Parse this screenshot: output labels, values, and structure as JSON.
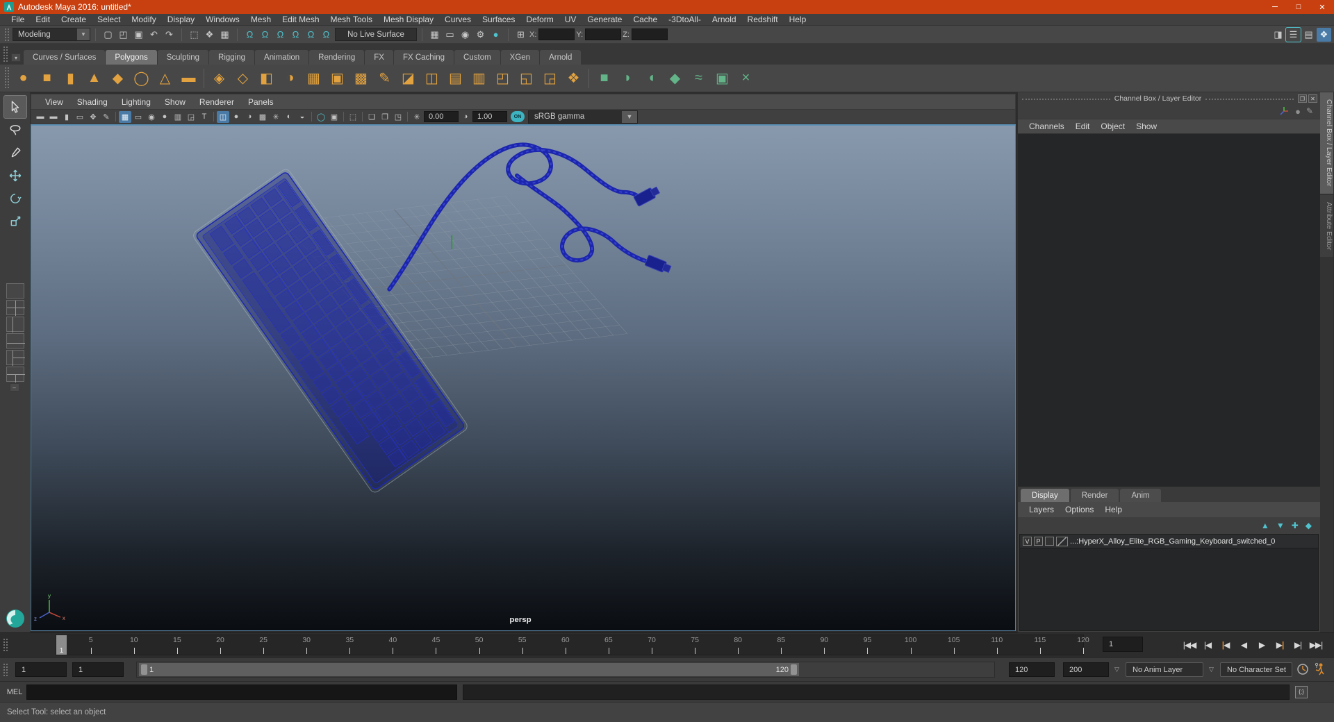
{
  "title_bar": {
    "title": "Autodesk Maya 2016: untitled*",
    "window_controls": [
      {
        "name": "minimize-button",
        "glyph": "─"
      },
      {
        "name": "maximize-button",
        "glyph": "□"
      },
      {
        "name": "close-button",
        "glyph": "✕"
      }
    ]
  },
  "menu_bar": {
    "items": [
      "File",
      "Edit",
      "Create",
      "Select",
      "Modify",
      "Display",
      "Windows",
      "Mesh",
      "Edit Mesh",
      "Mesh Tools",
      "Mesh Display",
      "Curves",
      "Surfaces",
      "Deform",
      "UV",
      "Generate",
      "Cache",
      "-3DtoAll-",
      "Arnold",
      "Redshift",
      "Help"
    ]
  },
  "toolbar": {
    "mode_dropdown": "Modeling",
    "live_surface": "No Live Surface",
    "axis_labels": {
      "x": "X:",
      "y": "Y:",
      "z": "Z:"
    },
    "file_icons": [
      {
        "n": "new-scene-icon",
        "g": "▢"
      },
      {
        "n": "open-scene-icon",
        "g": "◰"
      },
      {
        "n": "save-scene-icon",
        "g": "▣"
      },
      {
        "n": "undo-icon",
        "g": "↶"
      },
      {
        "n": "redo-icon",
        "g": "↷"
      }
    ],
    "selection_icons": [
      {
        "n": "select-hierarchy-icon",
        "g": "⬚"
      },
      {
        "n": "select-object-icon",
        "g": "❖",
        "active": true
      },
      {
        "n": "select-component-icon",
        "g": "▦"
      }
    ],
    "snap_icons": [
      {
        "n": "snap-to-grid-icon",
        "g": "Ω",
        "teal": true
      },
      {
        "n": "snap-to-curve-icon",
        "g": "Ω",
        "teal": true
      },
      {
        "n": "snap-to-point-icon",
        "g": "Ω",
        "teal": true
      },
      {
        "n": "snap-to-projected-center-icon",
        "g": "Ω",
        "teal": true
      },
      {
        "n": "snap-to-view-plane-icon",
        "g": "Ω",
        "teal": true
      },
      {
        "n": "make-live-icon",
        "g": "Ω",
        "teal": true
      }
    ],
    "render_icons": [
      {
        "n": "render-view-icon",
        "g": "▦"
      },
      {
        "n": "render-current-frame-icon",
        "g": "▭"
      },
      {
        "n": "ipr-render-icon",
        "g": "◉"
      },
      {
        "n": "render-settings-icon",
        "g": "⚙"
      },
      {
        "n": "render-setup-icon",
        "g": "●",
        "teal": true
      }
    ],
    "coord_icon": {
      "n": "input-position-icon",
      "g": "⊞"
    },
    "sidebar_toggles": [
      {
        "n": "attribute-editor-toggle-icon",
        "g": "◨"
      },
      {
        "n": "tool-settings-toggle-icon",
        "g": "☰",
        "activeline": true
      },
      {
        "n": "channel-box-toggle-icon",
        "g": "▤"
      },
      {
        "n": "modeling-toolkit-toggle-icon",
        "g": "❖",
        "activebg": true
      }
    ]
  },
  "shelf": {
    "tabs": [
      "Curves / Surfaces",
      "Polygons",
      "Sculpting",
      "Rigging",
      "Animation",
      "Rendering",
      "FX",
      "FX Caching",
      "Custom",
      "XGen",
      "Arnold"
    ],
    "active_tab": "Polygons",
    "icons": [
      {
        "n": "poly-sphere-icon",
        "g": "●",
        "c": "gold"
      },
      {
        "n": "poly-cube-icon",
        "g": "■",
        "c": "gold"
      },
      {
        "n": "poly-cylinder-icon",
        "g": "▮",
        "c": "gold"
      },
      {
        "n": "poly-cone-icon",
        "g": "▲",
        "c": "gold"
      },
      {
        "n": "poly-plane-icon",
        "g": "◆",
        "c": "gold"
      },
      {
        "n": "poly-torus-icon",
        "g": "◯",
        "c": "gold"
      },
      {
        "n": "poly-pyramid-icon",
        "g": "△",
        "c": "gold"
      },
      {
        "n": "poly-pipe-icon",
        "g": "▬",
        "c": "gold"
      },
      {
        "sep": true
      },
      {
        "n": "combine-icon",
        "g": "◈",
        "c": "gold"
      },
      {
        "n": "separate-icon",
        "g": "◇",
        "c": "gold"
      },
      {
        "n": "extract-icon",
        "g": "◧",
        "c": "gold"
      },
      {
        "n": "boolean-icon",
        "g": "◑",
        "c": "gold"
      },
      {
        "n": "fill-hole-icon",
        "g": "▦",
        "c": "gold"
      },
      {
        "n": "smooth-icon",
        "g": "▣",
        "c": "gold"
      },
      {
        "n": "reduce-icon",
        "g": "▩",
        "c": "gold"
      },
      {
        "n": "crease-tool-icon",
        "g": "✎",
        "c": "gold"
      },
      {
        "n": "extrude-icon",
        "g": "◪",
        "c": "gold"
      },
      {
        "n": "bevel-icon",
        "g": "◫",
        "c": "gold"
      },
      {
        "n": "bridge-icon",
        "g": "▤",
        "c": "gold"
      },
      {
        "n": "insert-edge-loop-icon",
        "g": "▥",
        "c": "gold"
      },
      {
        "n": "offset-edge-loop-icon",
        "g": "◰",
        "c": "gold"
      },
      {
        "n": "flip-triangle-icon",
        "g": "◱",
        "c": "gold"
      },
      {
        "n": "delete-edge-icon",
        "g": "◲",
        "c": "gold"
      },
      {
        "n": "quad-draw-icon",
        "g": "❖",
        "c": "gold"
      },
      {
        "sep": true
      },
      {
        "n": "sculpt-tool-icon",
        "g": "■",
        "c": "green"
      },
      {
        "n": "smooth-sculpt-icon",
        "g": "◗",
        "c": "green"
      },
      {
        "n": "relax-sculpt-icon",
        "g": "◖",
        "c": "green"
      },
      {
        "n": "grab-sculpt-icon",
        "g": "◆",
        "c": "green"
      },
      {
        "n": "pinch-sculpt-icon",
        "g": "≈",
        "c": "green"
      },
      {
        "n": "sculpt-settings-icon",
        "g": "▣",
        "c": "green"
      },
      {
        "n": "erase-sculpt-icon",
        "g": "×",
        "c": "green"
      }
    ]
  },
  "tool_box": {
    "tools": [
      {
        "n": "select-tool",
        "active": true
      },
      {
        "n": "lasso-select-tool"
      },
      {
        "n": "paint-select-tool"
      },
      {
        "n": "move-tool"
      },
      {
        "n": "rotate-tool"
      },
      {
        "n": "scale-tool"
      }
    ],
    "layouts": [
      "single-pane-layout",
      "four-pane-layout",
      "persp-outliner-layout",
      "persp-graph-layout",
      "hypershade-persp-layout",
      "persp-uv-layout"
    ]
  },
  "viewport": {
    "menus": [
      "View",
      "Shading",
      "Lighting",
      "Show",
      "Renderer",
      "Panels"
    ],
    "toolbar_icons": [
      {
        "n": "select-camera-icon",
        "g": "▬"
      },
      {
        "n": "lock-camera-icon",
        "g": "▬"
      },
      {
        "n": "camera-attributes-icon",
        "g": "▮"
      },
      {
        "n": "bookmark-icon",
        "g": "▭"
      },
      {
        "n": "camera-tools-icon",
        "g": "✥"
      },
      {
        "n": "grease-pencil-icon",
        "g": "✎"
      },
      {
        "sep": true
      },
      {
        "n": "grid-toggle-icon",
        "g": "▦",
        "activebg": true
      },
      {
        "n": "film-gate-icon",
        "g": "▭"
      },
      {
        "n": "resolution-gate-icon",
        "g": "◉"
      },
      {
        "n": "gate-mask-icon",
        "g": "●"
      },
      {
        "n": "field-chart-icon",
        "g": "▥"
      },
      {
        "n": "safe-action-icon",
        "g": "◲"
      },
      {
        "n": "safe-title-icon",
        "g": "T"
      },
      {
        "sep": true
      },
      {
        "n": "wireframe-icon",
        "g": "◫",
        "activebg": true
      },
      {
        "n": "shaded-icon",
        "g": "●"
      },
      {
        "n": "shaded-wireframe-icon",
        "g": "◑"
      },
      {
        "n": "textured-icon",
        "g": "▩"
      },
      {
        "n": "use-all-lights-icon",
        "g": "✳"
      },
      {
        "n": "shadows-icon",
        "g": "◐"
      },
      {
        "n": "occlusion-icon",
        "g": "◒"
      },
      {
        "sep": true
      },
      {
        "n": "motion-blur-icon",
        "g": "◯",
        "teal": true
      },
      {
        "n": "multisample-icon",
        "g": "▣"
      },
      {
        "sep": true
      },
      {
        "n": "isolate-select-icon",
        "g": "⬚"
      },
      {
        "sep": true
      },
      {
        "n": "xray-icon",
        "g": "❏"
      },
      {
        "n": "xray-active-icon",
        "g": "❐"
      },
      {
        "n": "plate-icon",
        "g": "◳"
      },
      {
        "sep": true
      },
      {
        "n": "exposure-icon",
        "g": "✳"
      }
    ],
    "exposure": "0.00",
    "contrast_icon": "◑",
    "gamma": "1.00",
    "toggle_on": "ON",
    "color_mode": "sRGB gamma",
    "camera_label": "persp"
  },
  "channel_box": {
    "title": "Channel Box / Layer Editor",
    "window_icons": [
      {
        "n": "float-panel-icon",
        "g": "❐"
      },
      {
        "n": "close-panel-icon",
        "g": "✕"
      }
    ],
    "menus": [
      "Channels",
      "Edit",
      "Object",
      "Show"
    ],
    "side_tabs": [
      {
        "label": "Channel Box / Layer Editor",
        "active": true
      },
      {
        "label": "Attribute Editor",
        "active": false
      }
    ]
  },
  "layer_editor": {
    "tabs": [
      "Display",
      "Render",
      "Anim"
    ],
    "active_tab": "Display",
    "menus": [
      "Layers",
      "Options",
      "Help"
    ],
    "icons": [
      {
        "n": "move-layer-up-icon",
        "g": "▲"
      },
      {
        "n": "move-layer-down-icon",
        "g": "▼"
      },
      {
        "n": "new-layer-with-objects-icon",
        "g": "✚"
      },
      {
        "n": "new-empty-layer-icon",
        "g": "◆"
      }
    ],
    "layer": {
      "visible": "V",
      "playback": "P",
      "name": "...:HyperX_Alloy_Elite_RGB_Gaming_Keyboard_switched_0"
    }
  },
  "timeline": {
    "start": 1,
    "end": 120,
    "label_step": 5,
    "current_frame": "1",
    "current_time_field": "1",
    "playback": [
      {
        "n": "go-to-start-button",
        "label": "|◀◀"
      },
      {
        "n": "step-back-frame-button",
        "label": "|◀"
      },
      {
        "n": "step-back-key-button",
        "label": "|◀",
        "accent": true
      },
      {
        "n": "play-backwards-button",
        "label": "◀"
      },
      {
        "n": "play-forward-button",
        "label": "▶"
      },
      {
        "n": "step-forward-key-button",
        "label": "▶|",
        "accent": true
      },
      {
        "n": "step-forward-frame-button",
        "label": "▶|"
      },
      {
        "n": "go-to-end-button",
        "label": "▶▶|"
      }
    ]
  },
  "range_slider": {
    "start_field": "1",
    "anim_start_field": "1",
    "range_start_label": "1",
    "range_end_label": "120",
    "end_field": "120",
    "anim_end_field": "200",
    "anim_layer": "No Anim Layer",
    "character_set": "No Character Set"
  },
  "command_line": {
    "label": "MEL",
    "script_editor_icon": "{;}"
  },
  "help_line": {
    "text": "Select Tool: select an object"
  },
  "colors": {
    "titlebar": "#c8400f",
    "accent_teal": "#4fc3ce",
    "accent_orange": "#d98a2e",
    "shelf_gold": "#e2a23f",
    "shelf_green": "#63b489",
    "wireframe_navy": "#1c27b2",
    "active_panel_border": "#5b8fb4"
  }
}
